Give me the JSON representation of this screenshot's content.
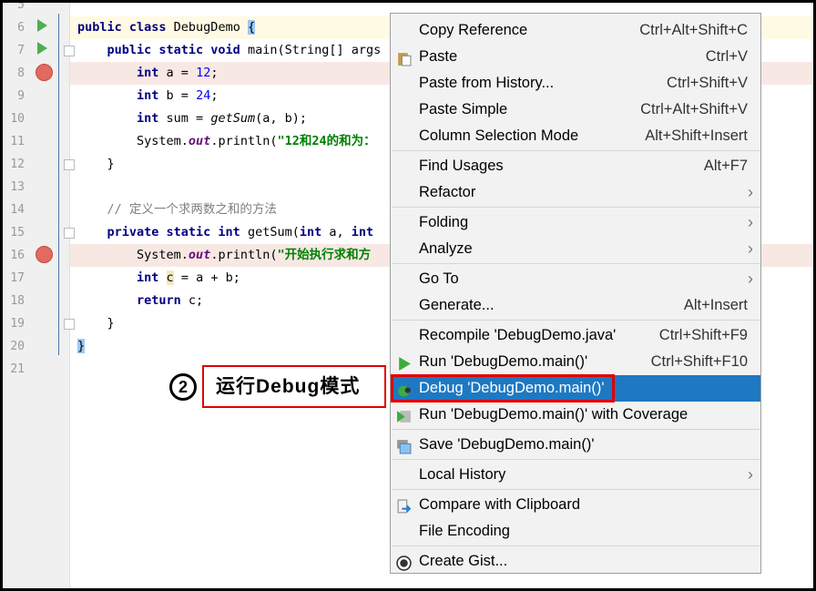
{
  "editor": {
    "line_numbers": [
      "5",
      "6",
      "7",
      "8",
      "9",
      "10",
      "11",
      "12",
      "13",
      "14",
      "15",
      "16",
      "17",
      "18",
      "19",
      "20",
      "21"
    ],
    "lines": [
      [],
      [
        [
          "public class ",
          "kw"
        ],
        [
          "DebugDemo ",
          ""
        ],
        [
          "{",
          "hl"
        ]
      ],
      [
        [
          "    public static void ",
          "kw"
        ],
        [
          "main(String[] args",
          ""
        ]
      ],
      [
        [
          "        int ",
          "kw"
        ],
        [
          "a = ",
          ""
        ],
        [
          "12",
          "num"
        ],
        [
          ";",
          ""
        ]
      ],
      [
        [
          "        int ",
          "kw"
        ],
        [
          "b = ",
          ""
        ],
        [
          "24",
          "num"
        ],
        [
          ";",
          ""
        ]
      ],
      [
        [
          "        int ",
          "kw"
        ],
        [
          "sum = ",
          ""
        ],
        [
          "getSum",
          "it"
        ],
        [
          "(a, b);",
          ""
        ]
      ],
      [
        [
          "        System.",
          ""
        ],
        [
          "out",
          "fld"
        ],
        [
          ".println(",
          ""
        ],
        [
          "\"12和24的和为：",
          "str"
        ]
      ],
      [
        [
          "    }",
          ""
        ]
      ],
      [],
      [
        [
          "    // 定义一个求两数之和的方法",
          "cm"
        ]
      ],
      [
        [
          "    private static int ",
          "kw"
        ],
        [
          "getSum(",
          ""
        ],
        [
          "int ",
          "kw"
        ],
        [
          "a, ",
          ""
        ],
        [
          "int",
          "kw"
        ]
      ],
      [
        [
          "        System.",
          ""
        ],
        [
          "out",
          "fld"
        ],
        [
          ".println(",
          ""
        ],
        [
          "\"开始执行求和方",
          "str"
        ]
      ],
      [
        [
          "        int ",
          "kw"
        ],
        [
          "c",
          "hly"
        ],
        [
          " = a + b;",
          ""
        ]
      ],
      [
        [
          "        return ",
          "kw"
        ],
        [
          "c;",
          ""
        ]
      ],
      [
        [
          "    }",
          ""
        ]
      ],
      [
        [
          "}",
          "hl"
        ]
      ],
      []
    ]
  },
  "menu": {
    "items": [
      {
        "label": "Copy Reference",
        "shortcut": "Ctrl+Alt+Shift+C"
      },
      {
        "label": "Paste",
        "shortcut": "Ctrl+V",
        "icon": "clipboard-icon"
      },
      {
        "label": "Paste from History...",
        "shortcut": "Ctrl+Shift+V"
      },
      {
        "label": "Paste Simple",
        "shortcut": "Ctrl+Alt+Shift+V"
      },
      {
        "label": "Column Selection Mode",
        "shortcut": "Alt+Shift+Insert",
        "sep_after": true
      },
      {
        "label": "Find Usages",
        "shortcut": "Alt+F7"
      },
      {
        "label": "Refactor",
        "submenu": true,
        "sep_after": true
      },
      {
        "label": "Folding",
        "submenu": true
      },
      {
        "label": "Analyze",
        "submenu": true,
        "sep_after": true
      },
      {
        "label": "Go To",
        "submenu": true
      },
      {
        "label": "Generate...",
        "shortcut": "Alt+Insert",
        "sep_after": true
      },
      {
        "label": "Recompile 'DebugDemo.java'",
        "shortcut": "Ctrl+Shift+F9"
      },
      {
        "label": "Run 'DebugDemo.main()'",
        "shortcut": "Ctrl+Shift+F10",
        "icon": "run-icon"
      },
      {
        "label": "Debug 'DebugDemo.main()'",
        "icon": "debug-bug-icon",
        "selected": true
      },
      {
        "label": "Run 'DebugDemo.main()' with Coverage",
        "icon": "coverage-icon",
        "sep_after": true
      },
      {
        "label": "Save 'DebugDemo.main()'",
        "icon": "save-config-icon",
        "sep_after": true
      },
      {
        "label": "Local History",
        "submenu": true,
        "sep_after": true
      },
      {
        "label": "Compare with Clipboard",
        "icon": "compare-icon"
      },
      {
        "label": "File Encoding",
        "sep_after": true
      },
      {
        "label": "Create Gist...",
        "icon": "github-icon"
      }
    ],
    "submenu_arrow": "›"
  },
  "annotation": {
    "step": "2",
    "text": "运行Debug模式",
    "color": "#e00000"
  },
  "colors": {
    "selection": "#1e78c2",
    "breakpoint": "#e06b5f"
  }
}
